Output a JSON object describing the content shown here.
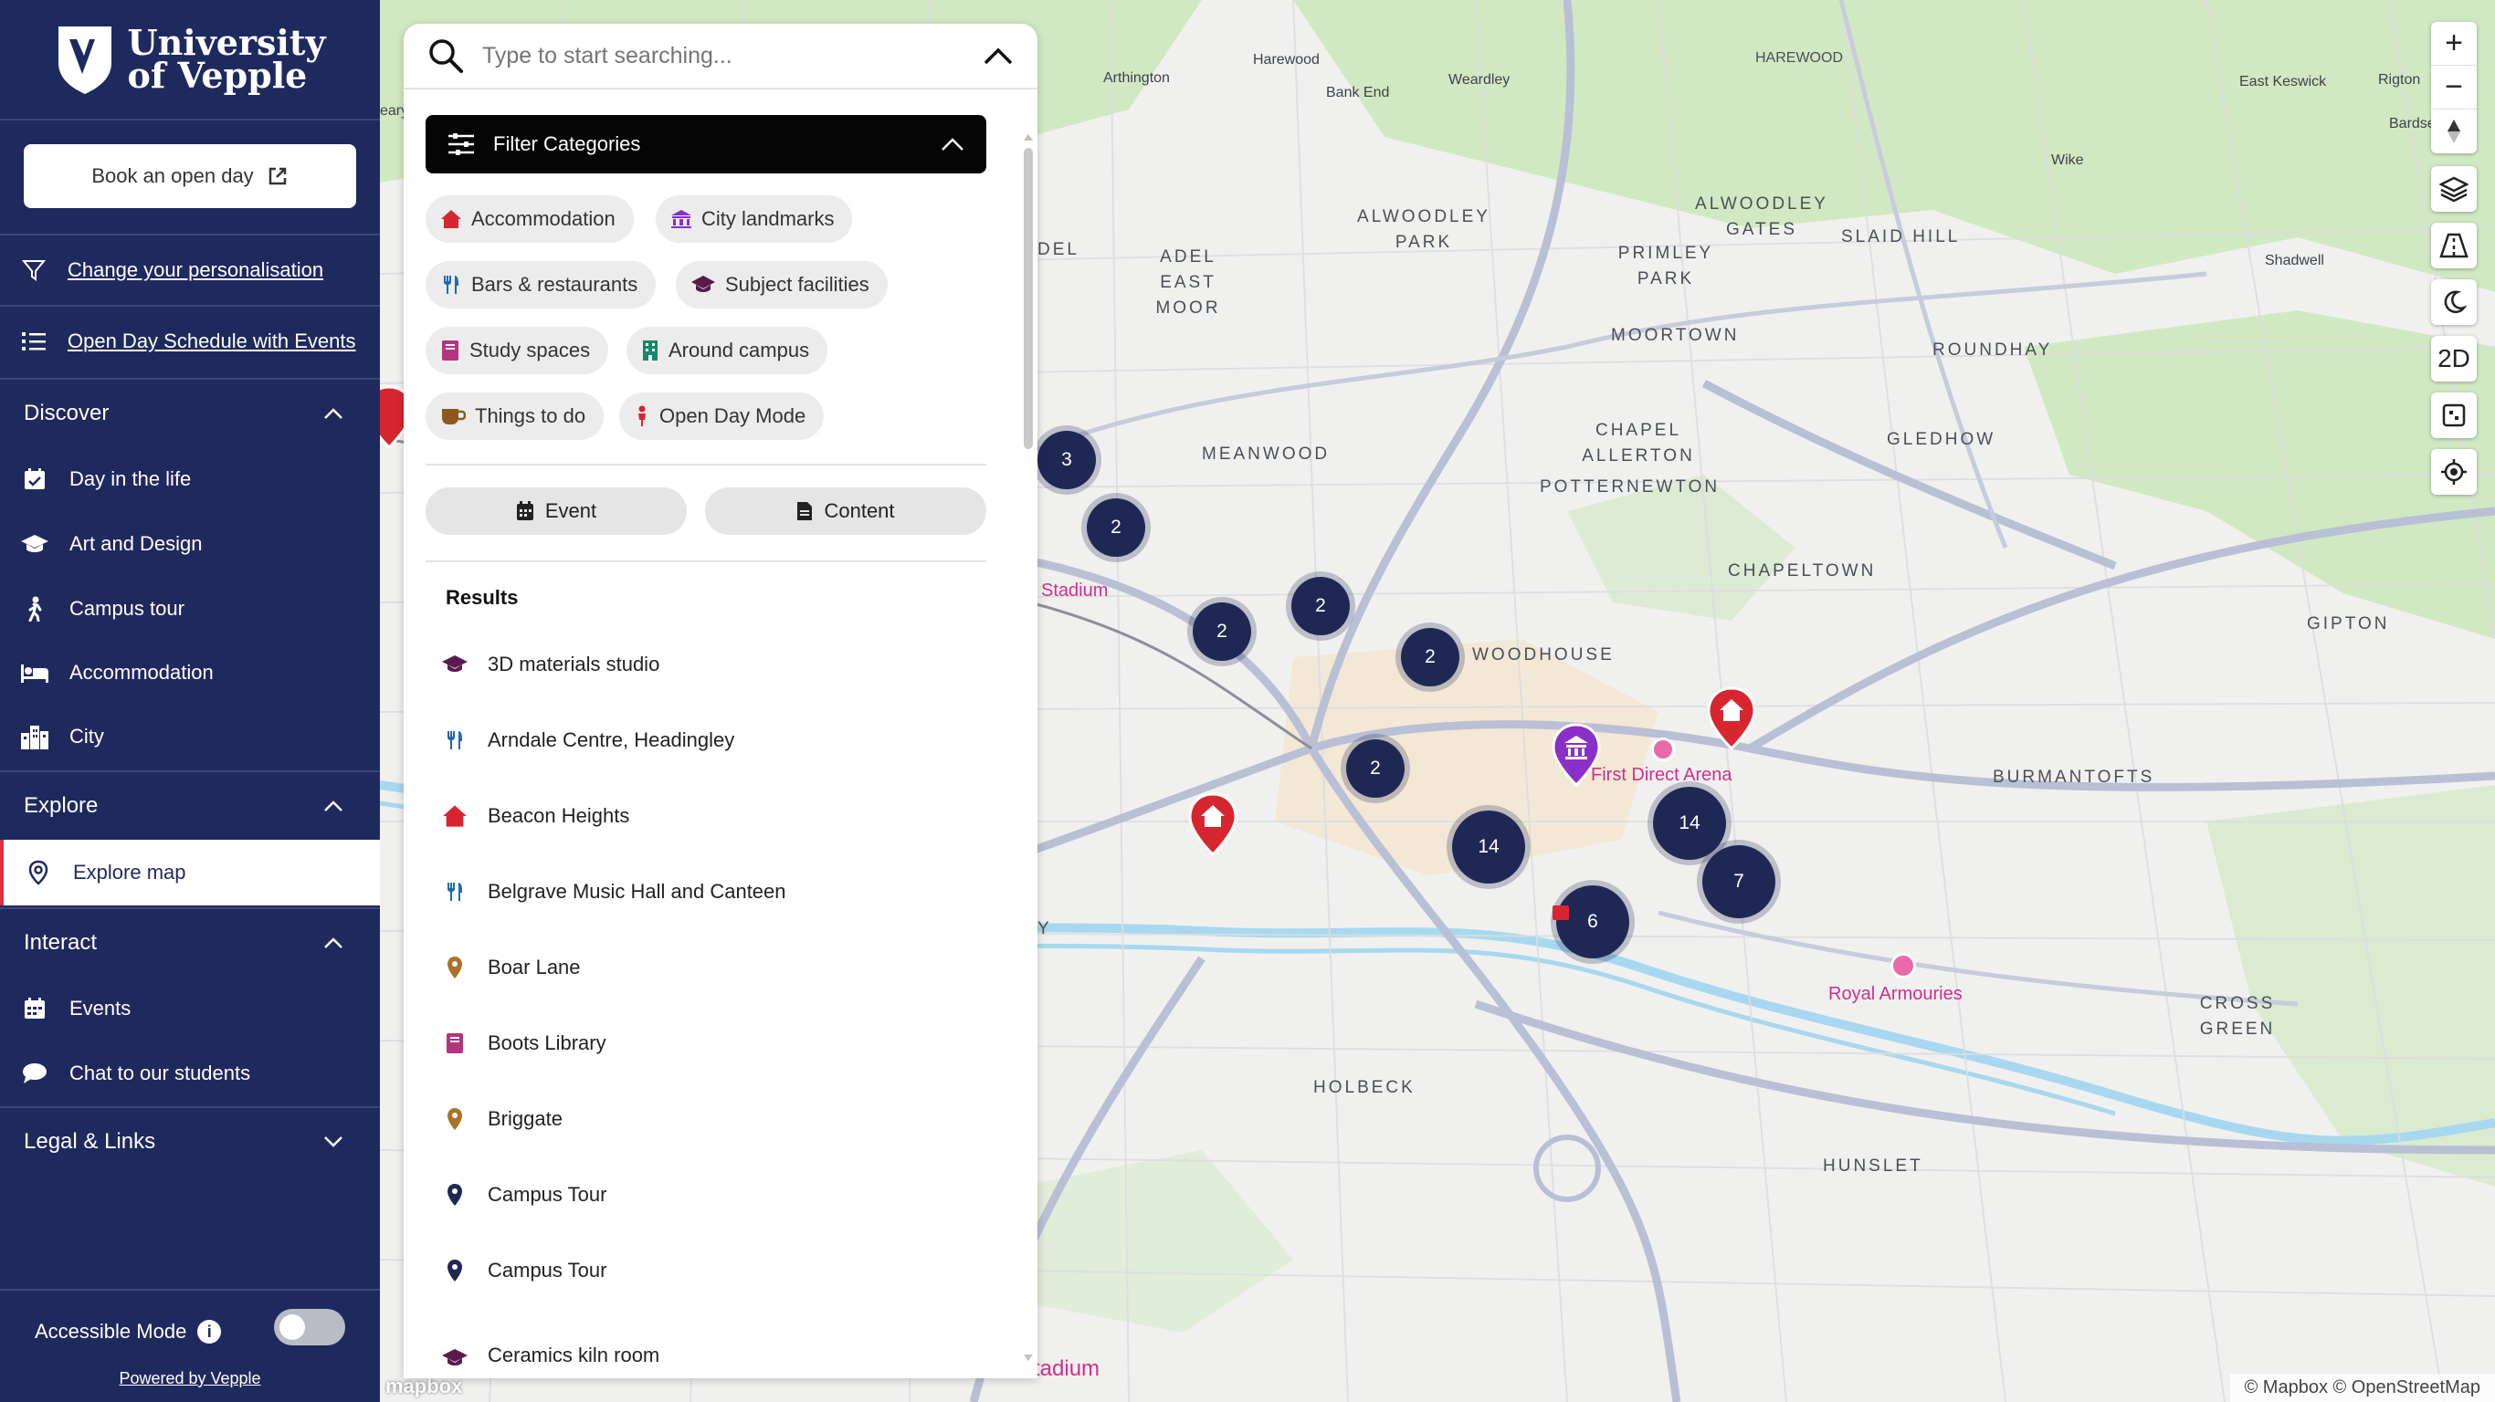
{
  "brand": {
    "line1": "University",
    "line2": "of Vepple"
  },
  "sidebar": {
    "book_label": "Book an open day",
    "personalisation_label": "Change your personalisation",
    "schedule_label": "Open Day Schedule with Events",
    "sections": {
      "discover": "Discover",
      "explore": "Explore",
      "interact": "Interact",
      "legal": "Legal & Links"
    },
    "discover_items": [
      "Day in the life",
      "Art and Design",
      "Campus tour",
      "Accommodation",
      "City"
    ],
    "explore_items": [
      "Explore map"
    ],
    "interact_items": [
      "Events",
      "Chat to our students"
    ],
    "accessible_label": "Accessible Mode",
    "accessible_on": false,
    "powered_label": "Powered by Vepple"
  },
  "search": {
    "placeholder": "Type to start searching...",
    "filter_label": "Filter Categories",
    "categories": [
      "Accommodation",
      "City landmarks",
      "Bars & restaurants",
      "Subject facilities",
      "Study spaces",
      "Around campus",
      "Things to do",
      "Open Day Mode"
    ],
    "type_buttons": [
      "Event",
      "Content"
    ],
    "results_title": "Results",
    "results": [
      "3D materials studio",
      "Arndale Centre, Headingley",
      "Beacon Heights",
      "Belgrave Music Hall and Canteen",
      "Boar Lane",
      "Boots Library",
      "Briggate",
      "Campus Tour",
      "Campus Tour",
      "Ceramics kiln room"
    ]
  },
  "map": {
    "places_large": [
      "HAREWOOD",
      "ALWOODLEY PARK",
      "ALWOODLEY GATES",
      "SLAID HILL",
      "ADEL EAST MOOR",
      "PRIMLEY PARK",
      "MOORTOWN",
      "ROUNDHAY",
      "MEANWOOD",
      "CHAPEL ALLERTON",
      "GLEDHOW",
      "POTTERNEWTON",
      "CHAPELTOWN",
      "GIPTON",
      "WOODHOUSE",
      "BURMANTOFTS",
      "CROSS GREEN",
      "HOLBECK",
      "HUNSLET",
      "DEL",
      "Y"
    ],
    "places_small": [
      "Arthington",
      "Bank End",
      "Weardley",
      "Harewood",
      "East Keswick",
      "Rigton",
      "Bardsey",
      "Wike",
      "Shadwell",
      "eary"
    ],
    "poi": [
      "First Direct Arena",
      "Royal Armouries",
      "Stadium",
      "Stadium"
    ],
    "clusters": [
      "3",
      "2",
      "2",
      "2",
      "2",
      "2",
      "14",
      "14",
      "7",
      "6"
    ],
    "controls": {
      "zoom_in": "+",
      "zoom_out": "−",
      "mode": "2D"
    },
    "attribution": "© Mapbox © OpenStreetMap",
    "mapbox_logo": "mapbox"
  },
  "colors": {
    "sidebar": "#1e2a5e",
    "cluster": "#1f2855",
    "pin_red": "#d7262f",
    "pin_purple": "#8a2fc9",
    "poi_pink": "#d62d8a"
  }
}
